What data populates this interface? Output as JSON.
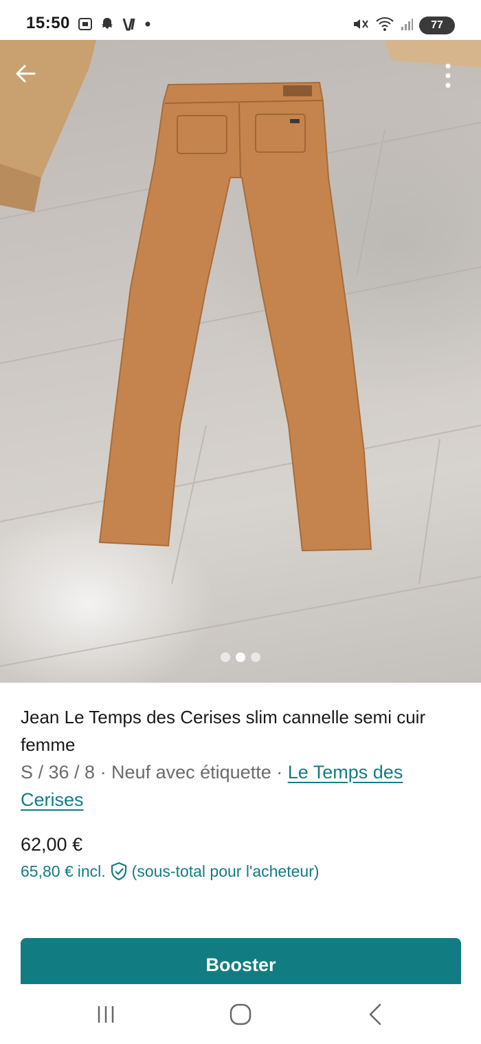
{
  "status_bar": {
    "time": "15:50",
    "battery": "77",
    "icons_left": [
      "screenshot-icon",
      "snapchat-icon",
      "vinted-icon",
      "dot-icon"
    ],
    "icons_right": [
      "mute-icon",
      "wifi-icon",
      "signal-icon",
      "battery-icon"
    ]
  },
  "photo": {
    "alt_subject": "jeans",
    "dots_count": 3,
    "active_dot": 1,
    "colors": {
      "jeans": "#c5844d",
      "floor": "#cdc8c3"
    }
  },
  "item": {
    "title": "Jean Le Temps des Cerises slim cannelle semi cuir femme",
    "meta": "S / 36 / 8 · Neuf avec étiquette · ",
    "brand_link": "Le Temps des Cerises",
    "price": "62,00 €",
    "price_incl_amount": "65,80 €",
    "price_incl_label": "incl.",
    "price_incl_note": "(sous-total pour l'acheteur)"
  },
  "actions": {
    "booster_label": "Booster"
  },
  "colors": {
    "accent": "#127c83",
    "text": "#1a1a1a",
    "muted": "#6b6b6b"
  },
  "nav": {
    "icons": [
      "recents-icon",
      "home-icon",
      "back-nav-icon"
    ]
  }
}
